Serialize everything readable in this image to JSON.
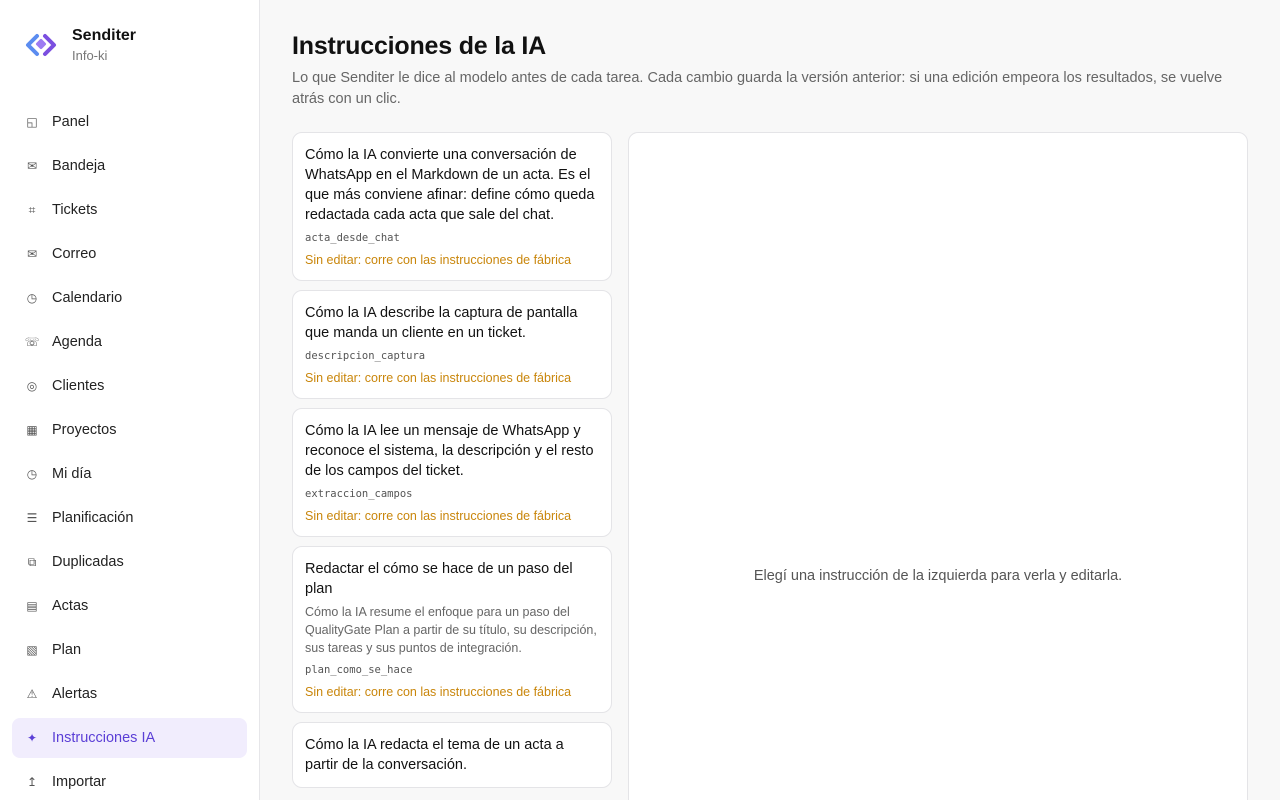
{
  "brand": {
    "name": "Senditer",
    "workspace": "Info-ki"
  },
  "nav": [
    {
      "label": "Panel",
      "icon": "panel-icon",
      "glyph": "◱"
    },
    {
      "label": "Bandeja",
      "icon": "inbox-icon",
      "glyph": "✉"
    },
    {
      "label": "Tickets",
      "icon": "ticket-icon",
      "glyph": "⌗"
    },
    {
      "label": "Correo",
      "icon": "mail-icon",
      "glyph": "✉"
    },
    {
      "label": "Calendario",
      "icon": "calendar-icon",
      "glyph": "◷"
    },
    {
      "label": "Agenda",
      "icon": "phone-icon",
      "glyph": "☏"
    },
    {
      "label": "Clientes",
      "icon": "clients-icon",
      "glyph": "◎"
    },
    {
      "label": "Proyectos",
      "icon": "projects-icon",
      "glyph": "▦"
    },
    {
      "label": "Mi día",
      "icon": "clock-icon",
      "glyph": "◷"
    },
    {
      "label": "Planificación",
      "icon": "planning-icon",
      "glyph": "☰"
    },
    {
      "label": "Duplicadas",
      "icon": "duplicates-icon",
      "glyph": "⧉"
    },
    {
      "label": "Actas",
      "icon": "minutes-icon",
      "glyph": "▤"
    },
    {
      "label": "Plan",
      "icon": "plan-icon",
      "glyph": "▧"
    },
    {
      "label": "Alertas",
      "icon": "alert-icon",
      "glyph": "⚠"
    },
    {
      "label": "Instrucciones IA",
      "icon": "sparkle-icon",
      "glyph": "✦",
      "active": true
    },
    {
      "label": "Importar",
      "icon": "import-icon",
      "glyph": "↥"
    }
  ],
  "page": {
    "title": "Instrucciones de la IA",
    "description": "Lo que Senditer le dice al modelo antes de cada tarea. Cada cambio guarda la versión anterior: si una edición empeora los resultados, se vuelve atrás con un clic."
  },
  "instructions": [
    {
      "title": "Cómo la IA convierte una conversación de WhatsApp en el Markdown de un acta. Es el que más conviene afinar: define cómo queda redactada cada acta que sale del chat.",
      "description": "",
      "key": "acta_desde_chat",
      "status": "Sin editar: corre con las instrucciones de fábrica"
    },
    {
      "title": "Cómo la IA describe la captura de pantalla que manda un cliente en un ticket.",
      "description": "",
      "key": "descripcion_captura",
      "status": "Sin editar: corre con las instrucciones de fábrica"
    },
    {
      "title": "Cómo la IA lee un mensaje de WhatsApp y reconoce el sistema, la descripción y el resto de los campos del ticket.",
      "description": "",
      "key": "extraccion_campos",
      "status": "Sin editar: corre con las instrucciones de fábrica"
    },
    {
      "title": "Redactar el cómo se hace de un paso del plan",
      "description": "Cómo la IA resume el enfoque para un paso del QualityGate Plan a partir de su título, su descripción, sus tareas y sus puntos de integración.",
      "key": "plan_como_se_hace",
      "status": "Sin editar: corre con las instrucciones de fábrica"
    },
    {
      "title": "Cómo la IA redacta el tema de un acta a partir de la conversación.",
      "description": "",
      "key": "",
      "status": ""
    }
  ],
  "detail": {
    "empty_text": "Elegí una instrucción de la izquierda para verla y editarla."
  },
  "colors": {
    "accent": "#5b3fd6",
    "active_bg": "#f1edfd",
    "status": "#c9860b"
  }
}
